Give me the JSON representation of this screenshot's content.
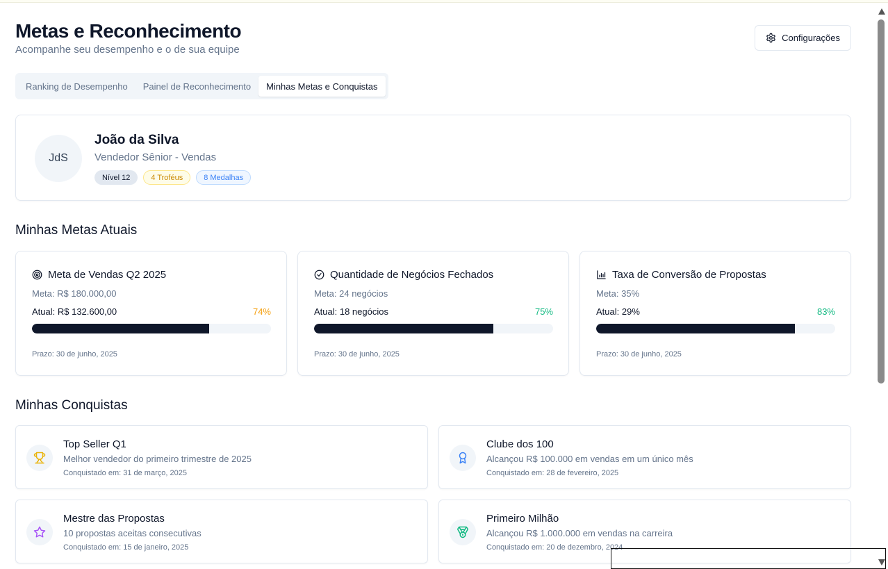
{
  "header": {
    "title": "Metas e Reconhecimento",
    "subtitle": "Acompanhe seu desempenho e o de sua equipe",
    "settings_label": "Configurações"
  },
  "tabs": [
    {
      "label": "Ranking de Desempenho",
      "active": false
    },
    {
      "label": "Painel de Reconhecimento",
      "active": false
    },
    {
      "label": "Minhas Metas e Conquistas",
      "active": true
    }
  ],
  "profile": {
    "initials": "JdS",
    "name": "João da Silva",
    "role": "Vendedor Sênior - Vendas",
    "badges": {
      "level": "Nível 12",
      "trophies": "4 Troféus",
      "medals": "8 Medalhas"
    }
  },
  "goals_section": {
    "title": "Minhas Metas Atuais",
    "goals": [
      {
        "icon": "target-icon",
        "title": "Meta de Vendas Q2 2025",
        "target": "Meta: R$ 180.000,00",
        "current": "Atual: R$ 132.600,00",
        "percent_label": "74%",
        "progress": 74,
        "percent_color": "#f59e0b",
        "deadline": "Prazo: 30 de junho, 2025"
      },
      {
        "icon": "check-circle-icon",
        "title": "Quantidade de Negócios Fechados",
        "target": "Meta: 24 negócios",
        "current": "Atual: 18 negócios",
        "percent_label": "75%",
        "progress": 75,
        "percent_color": "#10b981",
        "deadline": "Prazo: 30 de junho, 2025"
      },
      {
        "icon": "bar-chart-icon",
        "title": "Taxa de Conversão de Propostas",
        "target": "Meta: 35%",
        "current": "Atual: 29%",
        "percent_label": "83%",
        "progress": 83,
        "percent_color": "#10b981",
        "deadline": "Prazo: 30 de junho, 2025"
      }
    ]
  },
  "achievements_section": {
    "title": "Minhas Conquistas",
    "items": [
      {
        "icon": "trophy-icon",
        "title": "Top Seller Q1",
        "description": "Melhor vendedor do primeiro trimestre de 2025",
        "date": "Conquistado em: 31 de março, 2025",
        "icon_color": "#eab308"
      },
      {
        "icon": "award-icon",
        "title": "Clube dos 100",
        "description": "Alcançou R$ 100.000 em vendas em um único mês",
        "date": "Conquistado em: 28 de fevereiro, 2025",
        "icon_color": "#3b82f6"
      },
      {
        "icon": "star-icon",
        "title": "Mestre das Propostas",
        "description": "10 propostas aceitas consecutivas",
        "date": "Conquistado em: 15 de janeiro, 2025",
        "icon_color": "#a855f7"
      },
      {
        "icon": "medal-icon",
        "title": "Primeiro Milhão",
        "description": "Alcançou R$ 1.000.000 em vendas na carreira",
        "date": "Conquistado em: 20 de dezembro, 2024",
        "icon_color": "#10b981"
      }
    ]
  }
}
